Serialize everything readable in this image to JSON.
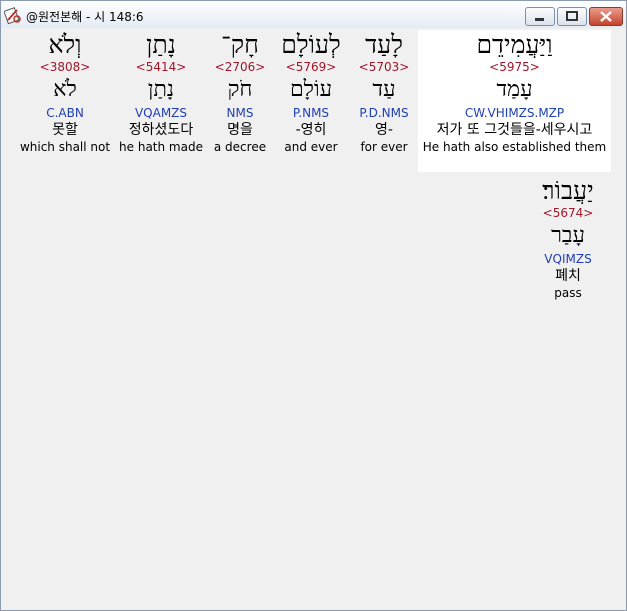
{
  "window": {
    "title": "@원전본해 - 시 148:6",
    "icon": "bible-app-icon",
    "controls": [
      "minimize-icon",
      "maximize-icon",
      "close-icon"
    ]
  },
  "words": [
    {
      "hebrew": "וַיַּעֲמִידֵם",
      "strong": "<5975>",
      "root": "עָמַד",
      "morph": "CW.VHIMZS.MZP",
      "korean": "저가 또 그것들을-세우시고",
      "english": "He hath also established them",
      "highlighted": true
    },
    {
      "hebrew": "לָעַד",
      "strong": "<5703>",
      "root": "עַד",
      "morph": "P.D.NMS",
      "korean": "영-",
      "english": "for ever",
      "highlighted": false
    },
    {
      "hebrew": "לְעוֹלָם",
      "strong": "<5769>",
      "root": "עוֹלָם",
      "morph": "P.NMS",
      "korean": "-영히",
      "english": "and ever",
      "highlighted": false
    },
    {
      "hebrew": "חָק־",
      "strong": "<2706>",
      "root": "חֹק",
      "morph": "NMS",
      "korean": "명을",
      "english": "a decree",
      "highlighted": false
    },
    {
      "hebrew": "נָתַן",
      "strong": "<5414>",
      "root": "נָתַן",
      "morph": "VQAMZS",
      "korean": "정하셨도다",
      "english": "he hath made",
      "highlighted": false
    },
    {
      "hebrew": "וְלֹא",
      "strong": "<3808>",
      "root": "לֹא",
      "morph": "C.ABN",
      "korean": "못할",
      "english": "which shall not",
      "highlighted": false
    },
    {
      "hebrew": "יַעֲבוֹר׃",
      "strong": "<5674>",
      "root": "עָבַר",
      "morph": "VQIMZS",
      "korean": "폐치",
      "english": "pass",
      "highlighted": false
    }
  ]
}
